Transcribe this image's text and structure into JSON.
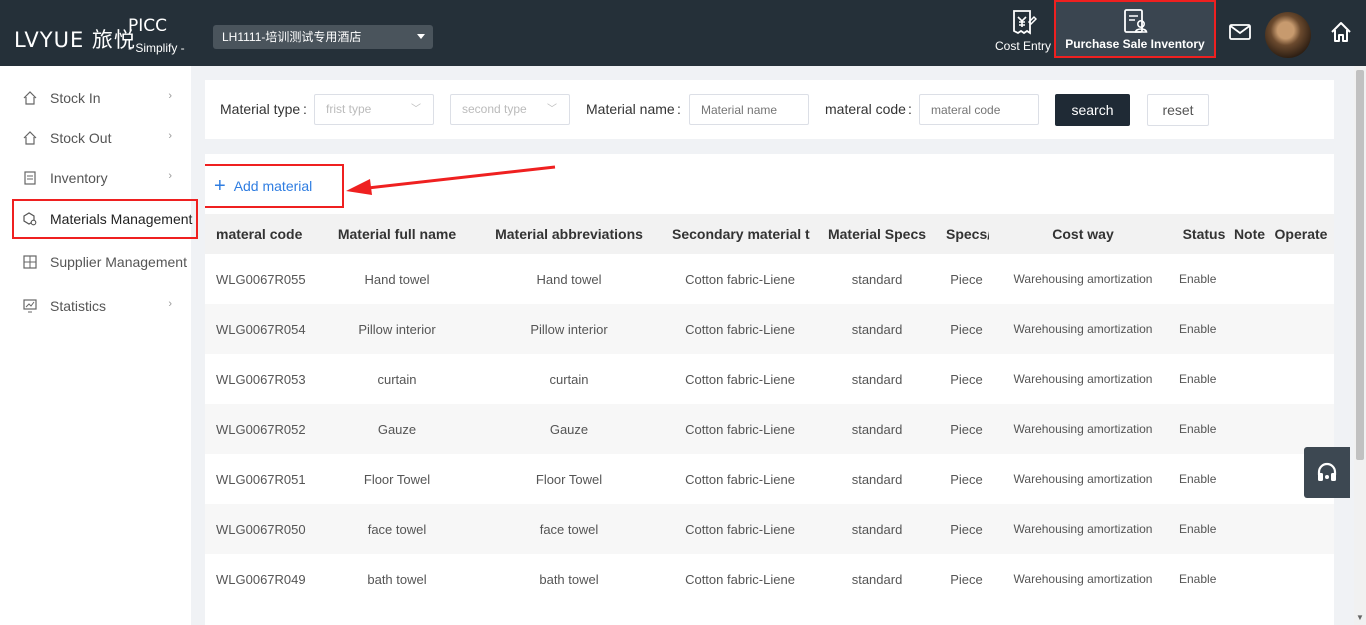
{
  "header": {
    "logo": "LVYUE 旅悦",
    "brand_name": "PICC",
    "brand_sub": "- Simplify -",
    "hotel": "LH1111-培训测试专用酒店",
    "cost_entry": "Cost Entry",
    "purchase_sale_inventory": "Purchase Sale Inventory"
  },
  "sidebar": {
    "items": [
      {
        "label": "Stock In",
        "icon": "home-icon"
      },
      {
        "label": "Stock Out",
        "icon": "home-icon"
      },
      {
        "label": "Inventory",
        "icon": "document-icon"
      },
      {
        "label": "Materials Management",
        "icon": "box-settings-icon"
      },
      {
        "label": "Supplier Management",
        "icon": "grid-icon"
      },
      {
        "label": "Statistics",
        "icon": "chart-icon"
      }
    ]
  },
  "filter": {
    "material_type_label": "Material type",
    "first_type_placeholder": "frist type",
    "second_type_placeholder": "second type",
    "material_name_label": "Material name",
    "material_name_placeholder": "Material name",
    "material_code_label": "materal code",
    "material_code_placeholder": "materal code",
    "search": "search",
    "reset": "reset"
  },
  "main": {
    "add_material": "Add material"
  },
  "table": {
    "headers": [
      "materal code",
      "Material full name",
      "Material abbreviations",
      "Secondary material type",
      "Material Specs",
      "Specs/unit",
      "Cost way",
      "Status",
      "Note",
      "Operate"
    ],
    "rows": [
      [
        "WLG0067R055",
        "Hand towel",
        "Hand towel",
        "Cotton fabric-Liene",
        "standard",
        "Piece",
        "Warehousing amortization",
        "Enable",
        ""
      ],
      [
        "WLG0067R054",
        "Pillow interior",
        "Pillow interior",
        "Cotton fabric-Liene",
        "standard",
        "Piece",
        "Warehousing amortization",
        "Enable",
        ""
      ],
      [
        "WLG0067R053",
        "curtain",
        "curtain",
        "Cotton fabric-Liene",
        "standard",
        "Piece",
        "Warehousing amortization",
        "Enable",
        ""
      ],
      [
        "WLG0067R052",
        "Gauze",
        "Gauze",
        "Cotton fabric-Liene",
        "standard",
        "Piece",
        "Warehousing amortization",
        "Enable",
        ""
      ],
      [
        "WLG0067R051",
        "Floor Towel",
        "Floor Towel",
        "Cotton fabric-Liene",
        "standard",
        "Piece",
        "Warehousing amortization",
        "Enable",
        ""
      ],
      [
        "WLG0067R050",
        "face towel",
        "face towel",
        "Cotton fabric-Liene",
        "standard",
        "Piece",
        "Warehousing amortization",
        "Enable",
        ""
      ],
      [
        "WLG0067R049",
        "bath towel",
        "bath towel",
        "Cotton fabric-Liene",
        "standard",
        "Piece",
        "Warehousing amortization",
        "Enable",
        ""
      ]
    ]
  },
  "colors": {
    "topbar": "#253039",
    "accent_blue": "#2f7de1",
    "highlight_red": "#ef2020",
    "search_button": "#1f2a35"
  }
}
